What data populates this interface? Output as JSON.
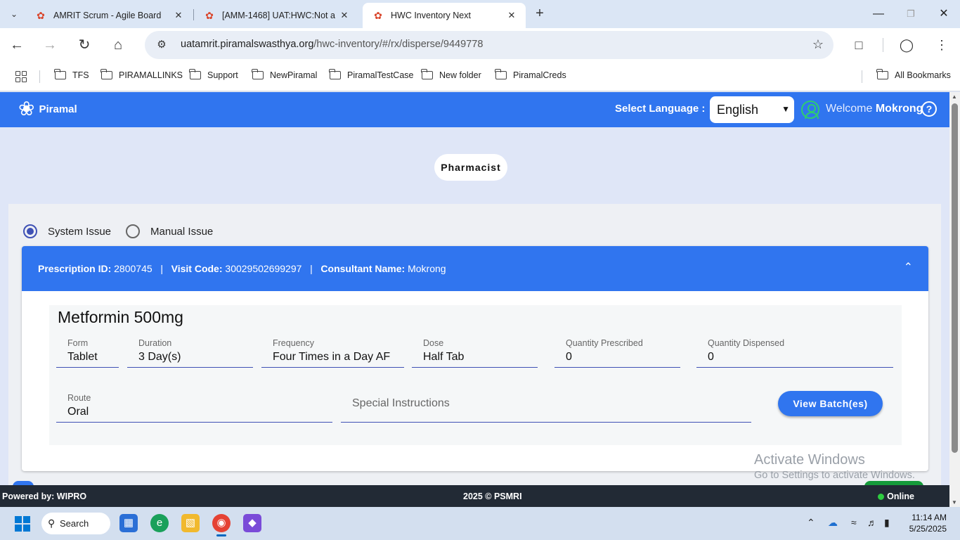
{
  "browser": {
    "tabs": [
      {
        "label": "AMRIT Scrum - Agile Board",
        "active": false
      },
      {
        "label": "[AMM-1468] UAT:HWC:Not a",
        "active": false
      },
      {
        "label": "HWC Inventory Next",
        "active": true
      }
    ],
    "url_host": "uatamrit.piramalswasthya.org",
    "url_path": "/hwc-inventory/#/rx/disperse/9449778",
    "bookmarks": [
      "TFS",
      "PIRAMALLINKS",
      "Support",
      "NewPiramal",
      "PiramalTestCase",
      "New folder",
      "PiramalCreds"
    ],
    "all_bookmarks": "All Bookmarks"
  },
  "app": {
    "logo_text": "Piramal",
    "select_language_label": "Select Language :",
    "language": "English",
    "welcome": "Welcome",
    "user_name": "Mokrong",
    "role": "Pharmacist"
  },
  "issue_mode": {
    "options": [
      "System Issue",
      "Manual Issue"
    ],
    "selected": "System Issue"
  },
  "prescription": {
    "id_label": "Prescription ID:",
    "id": "2800745",
    "visit_label": "Visit Code:",
    "visit_code": "30029502699297",
    "consultant_label": "Consultant Name:",
    "consultant": "Mokrong",
    "drug": {
      "name": "Metformin 500mg",
      "form_label": "Form",
      "form": "Tablet",
      "duration_label": "Duration",
      "duration": "3 Day(s)",
      "frequency_label": "Frequency",
      "frequency": "Four Times in a Day AF",
      "dose_label": "Dose",
      "dose": "Half Tab",
      "qty_prescribed_label": "Quantity Prescribed",
      "qty_prescribed": "0",
      "qty_dispensed_label": "Quantity Dispensed",
      "qty_dispensed": "0",
      "route_label": "Route",
      "route": "Oral",
      "special_instructions_placeholder": "Special Instructions"
    },
    "view_batches_label": "View Batch(es)"
  },
  "watermark": {
    "line1": "Activate Windows",
    "line2": "Go to Settings to activate Windows."
  },
  "footer": {
    "powered_by": "Powered by: WIPRO",
    "copyright": "2025 © PSMRI",
    "status": "Online"
  },
  "taskbar": {
    "search_label": "Search",
    "time": "11:14 AM",
    "date": "5/25/2025"
  },
  "colors": {
    "primary": "#3075ef",
    "footer_bg": "#222a35",
    "online": "#2ecc40"
  }
}
